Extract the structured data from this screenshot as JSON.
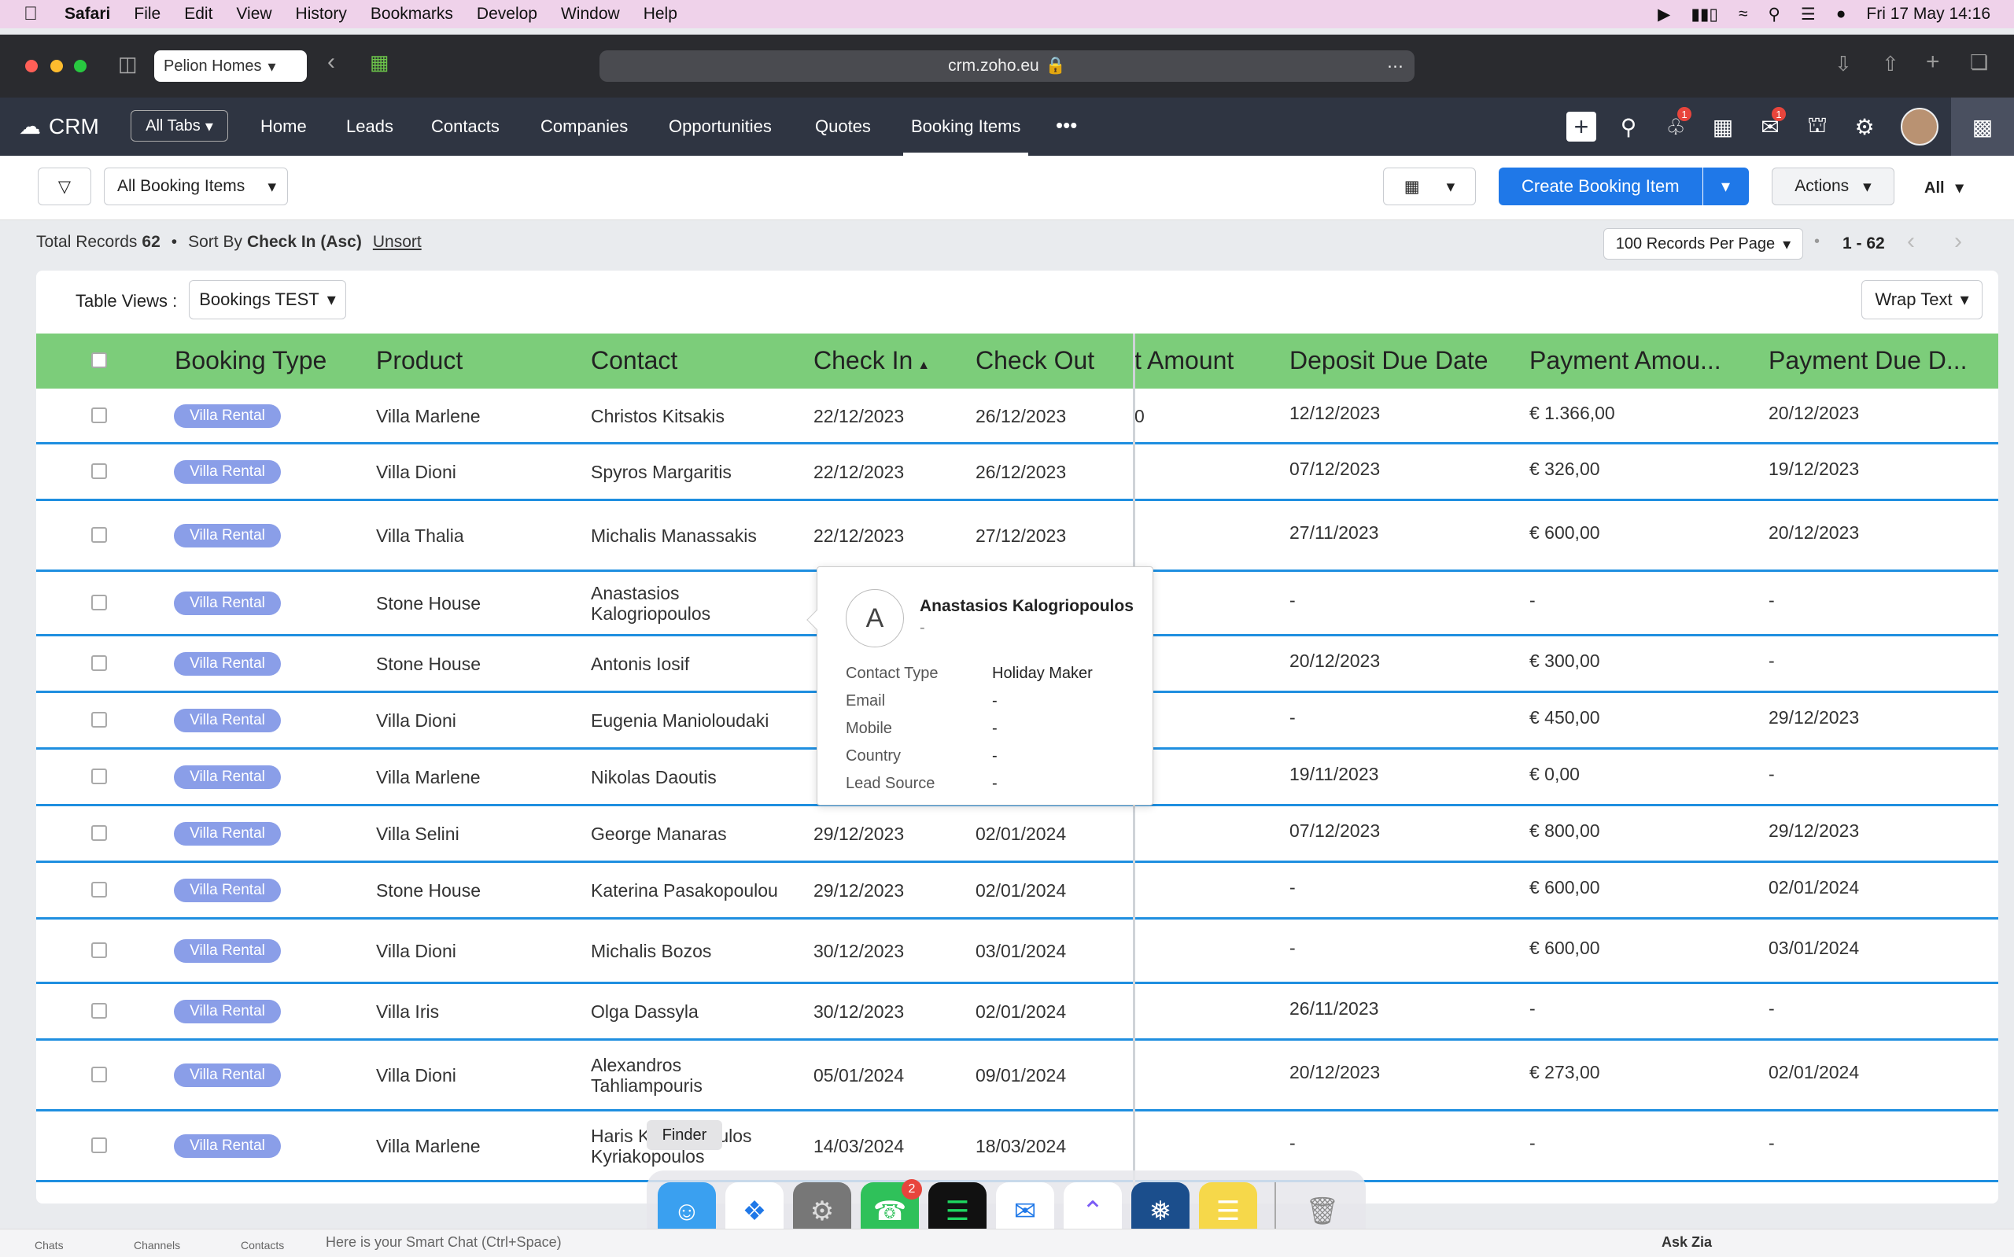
{
  "menubar": {
    "items": [
      "Safari",
      "File",
      "Edit",
      "View",
      "History",
      "Bookmarks",
      "Develop",
      "Window",
      "Help"
    ],
    "clock": "Fri 17 May  14:16"
  },
  "browser": {
    "tab_group": "Pelion Homes",
    "url": "crm.zoho.eu"
  },
  "crm": {
    "logo": "CRM",
    "all_tabs": "All Tabs",
    "tabs": [
      "Home",
      "Leads",
      "Contacts",
      "Companies",
      "Opportunities",
      "Quotes",
      "Booking Items"
    ],
    "more": "•••",
    "notif_badge": "1",
    "mail_badge": "1"
  },
  "toolbar": {
    "view_select": "All Booking Items",
    "create": "Create Booking Item",
    "actions": "Actions",
    "all": "All"
  },
  "summary": {
    "total_label": "Total Records",
    "total": "62",
    "sort_label": "Sort By",
    "sort_value": "Check In (Asc)",
    "unsort": "Unsort",
    "per_page": "100 Records Per Page",
    "range": "1 - 62"
  },
  "table": {
    "views_label": "Table Views :",
    "view": "Bookings TEST",
    "wrap": "Wrap Text",
    "headers": [
      "Booking Type",
      "Product",
      "Contact",
      "Check In",
      "Check Out",
      "t Amount",
      "Deposit Due Date",
      "Payment Amou...",
      "Payment Due D..."
    ],
    "rows": [
      {
        "type": "Villa Rental",
        "product": "Villa Marlene",
        "contact": "Christos Kitsakis",
        "contact2": "",
        "in": "22/12/2023",
        "out": "26/12/2023",
        "amt": "0",
        "dep": "12/12/2023",
        "pay": "€ 1.366,00",
        "due": "20/12/2023"
      },
      {
        "type": "Villa Rental",
        "product": "Villa Dioni",
        "contact": "Spyros Margaritis",
        "contact2": "",
        "in": "22/12/2023",
        "out": "26/12/2023",
        "amt": "",
        "dep": "07/12/2023",
        "pay": "€ 326,00",
        "due": "19/12/2023"
      },
      {
        "type": "Villa Rental",
        "product": "Villa Thalia",
        "contact": "Michalis Manassakis",
        "contact2": "",
        "in": "22/12/2023",
        "out": "27/12/2023",
        "amt": "",
        "dep": "27/11/2023",
        "pay": "€ 600,00",
        "due": "20/12/2023"
      },
      {
        "type": "Villa Rental",
        "product": "Stone House",
        "contact": "Anastasios",
        "contact2": "Kalogriopoulos",
        "in": "",
        "out": "",
        "amt": "",
        "dep": "-",
        "pay": "-",
        "due": "-"
      },
      {
        "type": "Villa Rental",
        "product": "Stone House",
        "contact": "Antonis Iosif",
        "contact2": "",
        "in": "",
        "out": "",
        "amt": "",
        "dep": "20/12/2023",
        "pay": "€ 300,00",
        "due": "-"
      },
      {
        "type": "Villa Rental",
        "product": "Villa Dioni",
        "contact": "Eugenia Manioloudaki",
        "contact2": "",
        "in": "",
        "out": "",
        "amt": "",
        "dep": "-",
        "pay": "€ 450,00",
        "due": "29/12/2023"
      },
      {
        "type": "Villa Rental",
        "product": "Villa Marlene",
        "contact": "Nikolas Daoutis",
        "contact2": "",
        "in": "",
        "out": "",
        "amt": "",
        "dep": "19/11/2023",
        "pay": "€ 0,00",
        "due": "-"
      },
      {
        "type": "Villa Rental",
        "product": "Villa Selini",
        "contact": "George Manaras",
        "contact2": "",
        "in": "29/12/2023",
        "out": "02/01/2024",
        "amt": "",
        "dep": "07/12/2023",
        "pay": "€ 800,00",
        "due": "29/12/2023"
      },
      {
        "type": "Villa Rental",
        "product": "Stone House",
        "contact": "Katerina Pasakopoulou",
        "contact2": "",
        "in": "29/12/2023",
        "out": "02/01/2024",
        "amt": "",
        "dep": "-",
        "pay": "€ 600,00",
        "due": "02/01/2024"
      },
      {
        "type": "Villa Rental",
        "product": "Villa Dioni",
        "contact": "Michalis Bozos",
        "contact2": "",
        "in": "30/12/2023",
        "out": "03/01/2024",
        "amt": "",
        "dep": "-",
        "pay": "€ 600,00",
        "due": "03/01/2024"
      },
      {
        "type": "Villa Rental",
        "product": "Villa Iris",
        "contact": "Olga Dassyla",
        "contact2": "",
        "in": "30/12/2023",
        "out": "02/01/2024",
        "amt": "",
        "dep": "26/11/2023",
        "pay": "-",
        "due": "-"
      },
      {
        "type": "Villa Rental",
        "product": "Villa Dioni",
        "contact": "Alexandros",
        "contact2": "Tahliampouris",
        "in": "05/01/2024",
        "out": "09/01/2024",
        "amt": "",
        "dep": "20/12/2023",
        "pay": "€ 273,00",
        "due": "02/01/2024"
      },
      {
        "type": "Villa Rental",
        "product": "Villa Marlene",
        "contact": "Haris Kyriakopoulos",
        "contact2": "Kyriakopoulos",
        "in": "14/03/2024",
        "out": "18/03/2024",
        "amt": "",
        "dep": "-",
        "pay": "-",
        "due": "-"
      }
    ]
  },
  "popup": {
    "avatar": "A",
    "name": "Anastasios Kalogriopoulos",
    "sub": "-",
    "fields": [
      [
        "Contact Type",
        "Holiday Maker"
      ],
      [
        "Email",
        "-"
      ],
      [
        "Mobile",
        "-"
      ],
      [
        "Country",
        "-"
      ],
      [
        "Lead Source",
        "-"
      ]
    ]
  },
  "dock": {
    "tooltip": "Finder",
    "whatsapp_badge": "2"
  },
  "footer": {
    "chat": "Chats",
    "channels": "Channels",
    "contacts": "Contacts",
    "smartchat": "Here is your Smart Chat (Ctrl+Space)",
    "askzia": "Ask Zia"
  }
}
